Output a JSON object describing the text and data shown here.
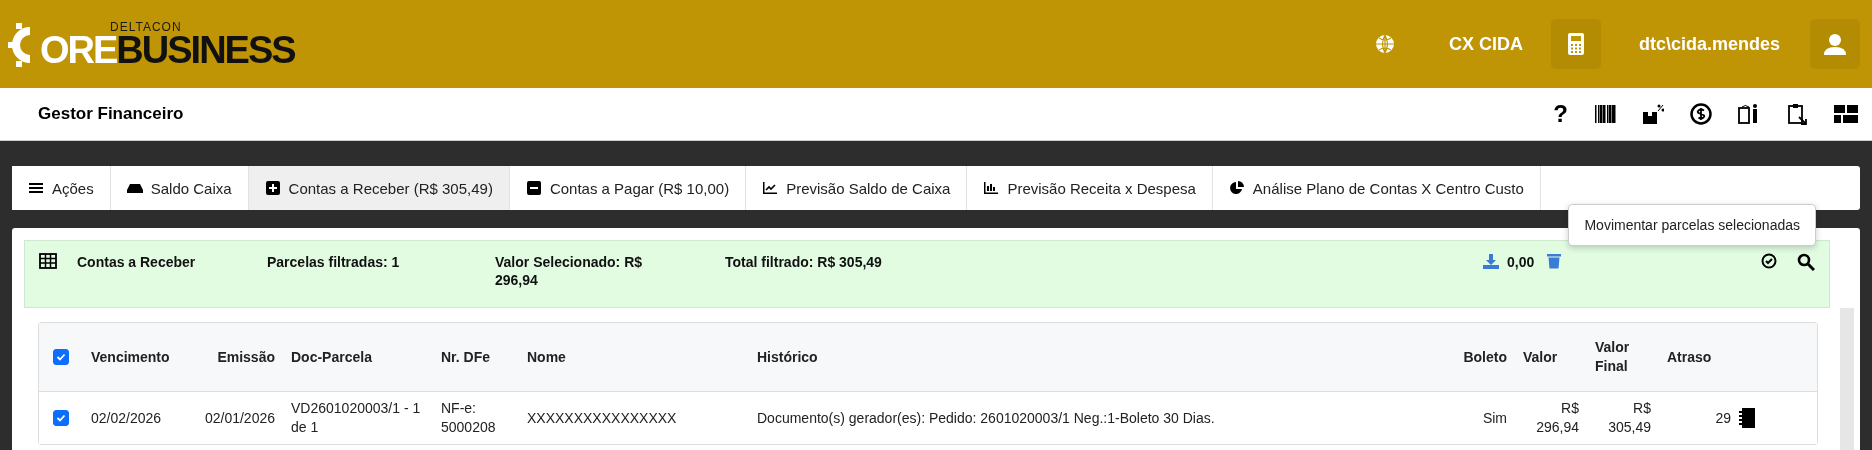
{
  "header": {
    "logo": {
      "brand_top": "DELTACON",
      "brand_light": "ORE",
      "brand_dark": "BUSINESS"
    },
    "cash_register": "CX CIDA",
    "user": "dtc\\cida.mendes"
  },
  "subheader": {
    "title": "Gestor Financeiro",
    "help": "?"
  },
  "tabs": [
    {
      "label": "Ações",
      "selected": false
    },
    {
      "label": "Saldo Caixa",
      "selected": false
    },
    {
      "label": "Contas a Receber (R$ 305,49)",
      "selected": true
    },
    {
      "label": "Contas a Pagar (R$ 10,00)",
      "selected": false
    },
    {
      "label": "Previsão Saldo de Caixa",
      "selected": false
    },
    {
      "label": "Previsão Receita x Despesa",
      "selected": false
    },
    {
      "label": "Análise Plano de Contas X Centro Custo",
      "selected": false
    }
  ],
  "summary": {
    "title": "Contas a Receber",
    "filtered_count": "Parcelas filtradas: 1",
    "selected_value": "Valor Selecionado: R$ 296,94",
    "filtered_total": "Total filtrado: R$ 305,49",
    "discount_value": "0,00"
  },
  "tooltip": "Movimentar parcelas selecionadas",
  "table": {
    "all_checked": true,
    "columns": [
      "Vencimento",
      "Emissão",
      "Doc-Parcela",
      "Nr. DFe",
      "Nome",
      "Histórico",
      "Boleto",
      "Valor",
      "Valor Final",
      "Atraso"
    ],
    "rows": [
      {
        "checked": true,
        "cells": [
          "02/02/2026",
          "02/01/2026",
          "VD2601020003/1 - 1 de 1",
          "NF-e: 5000208",
          "XXXXXXXXXXXXXXXX",
          "Documento(s) gerador(es): Pedido: 2601020003/1 Neg.:1-Boleto 30 Dias.",
          "Sim",
          "R$ 296,94",
          "R$ 305,49",
          "29"
        ]
      }
    ]
  }
}
